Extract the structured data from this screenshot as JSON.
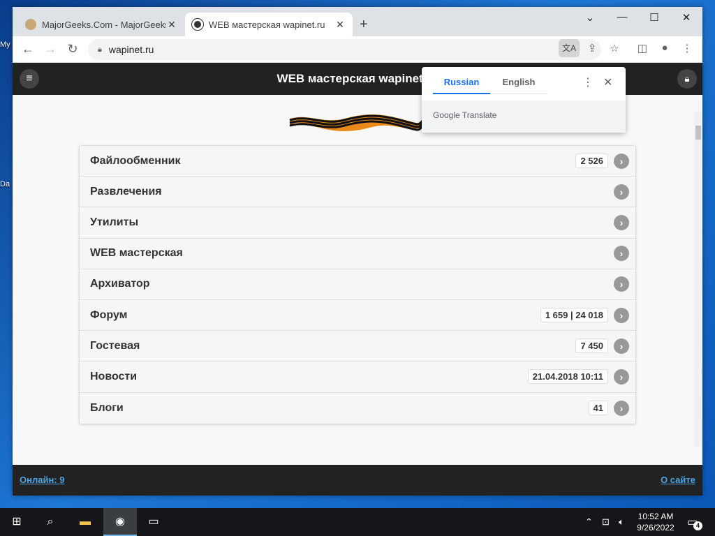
{
  "desktop": {
    "icon_labels": [
      "My",
      "Da"
    ]
  },
  "browser": {
    "tabs": [
      {
        "title": "MajorGeeks.Com - MajorGeeks",
        "active": false
      },
      {
        "title": "WEB мастерская wapinet.ru",
        "active": true
      }
    ],
    "address": "wapinet.ru",
    "window_controls": {
      "minimize": "—",
      "maximize": "☐",
      "close": "✕",
      "tab_search": "⌄"
    }
  },
  "site": {
    "title": "WEB мастерская wapinet.ru",
    "menu": [
      {
        "label": "Файлообменник",
        "count": "2 526"
      },
      {
        "label": "Развлечения",
        "count": ""
      },
      {
        "label": "Утилиты",
        "count": ""
      },
      {
        "label": "WEB мастерская",
        "count": ""
      },
      {
        "label": "Архиватор",
        "count": ""
      },
      {
        "label": "Форум",
        "count": "1 659 | 24 018"
      },
      {
        "label": "Гостевая",
        "count": "7 450"
      },
      {
        "label": "Новости",
        "count": "21.04.2018 10:11"
      },
      {
        "label": "Блоги",
        "count": "41"
      }
    ],
    "footer": {
      "online": "Онлайн: 9",
      "about": "О сайте"
    }
  },
  "translate_popup": {
    "source_lang": "Russian",
    "target_lang": "English",
    "brand": "Google Translate"
  },
  "taskbar": {
    "time": "10:52 AM",
    "date": "9/26/2022",
    "notification_count": "4"
  },
  "colors": {
    "site_header": "#222222",
    "accent_blue": "#1a73e8",
    "link_blue": "#4fa3e0"
  }
}
